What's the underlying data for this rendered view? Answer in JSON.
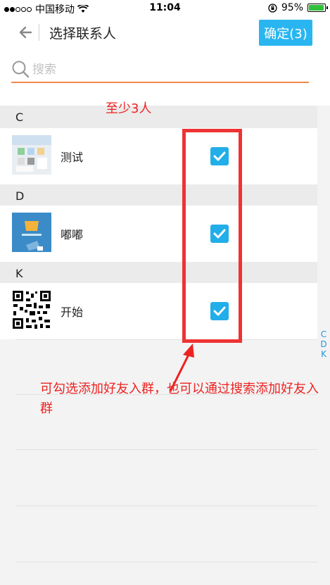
{
  "status_bar": {
    "carrier": "中国移动",
    "time": "11:04",
    "battery": "95%",
    "battery_level": 0.95
  },
  "nav": {
    "title": "选择联系人",
    "confirm_label": "确定(3)"
  },
  "search": {
    "placeholder": "搜索"
  },
  "sections": [
    {
      "letter": "C",
      "contacts": [
        {
          "name": "测试",
          "checked": true
        }
      ]
    },
    {
      "letter": "D",
      "contacts": [
        {
          "name": "嘟嘟",
          "checked": true
        }
      ]
    },
    {
      "letter": "K",
      "contacts": [
        {
          "name": "开始",
          "checked": true
        }
      ]
    }
  ],
  "index_bar": [
    "C",
    "D",
    "K"
  ],
  "annotations": {
    "min_note": "至少3人",
    "hint": "可勾选添加好友入群，也可以通过搜索添加好友入群"
  },
  "colors": {
    "accent": "#29b6f0",
    "search_underline": "#f08a4b",
    "annotation_red": "#ee2222"
  }
}
